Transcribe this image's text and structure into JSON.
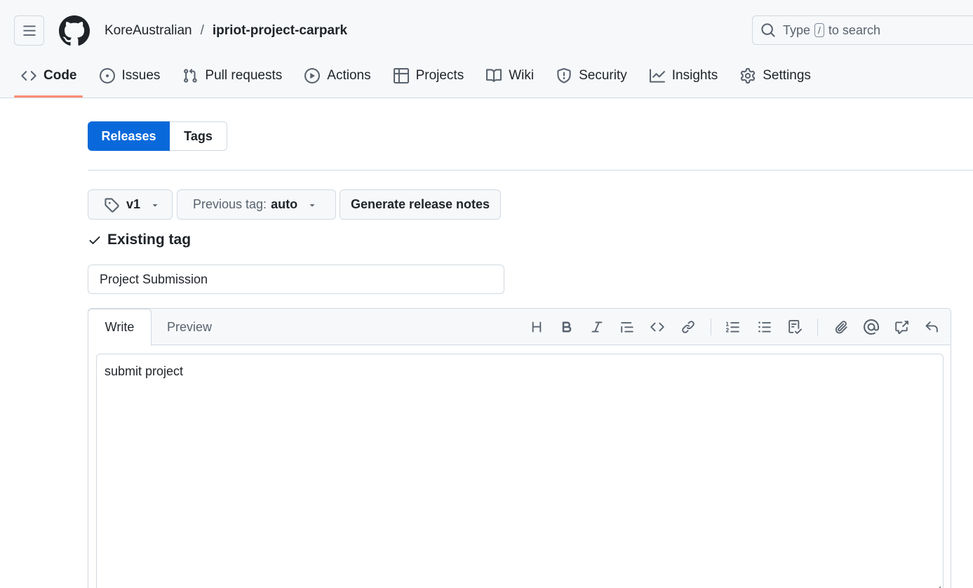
{
  "header": {
    "owner": "KoreAustralian",
    "separator": "/",
    "repo": "ipriot-project-carpark",
    "search": {
      "prefix": "Type",
      "key": "/",
      "suffix": "to search"
    }
  },
  "nav": [
    {
      "label": "Code",
      "icon": "code-icon",
      "active": true
    },
    {
      "label": "Issues",
      "icon": "issue-opened-icon"
    },
    {
      "label": "Pull requests",
      "icon": "git-pull-request-icon"
    },
    {
      "label": "Actions",
      "icon": "play-icon"
    },
    {
      "label": "Projects",
      "icon": "table-icon"
    },
    {
      "label": "Wiki",
      "icon": "book-icon"
    },
    {
      "label": "Security",
      "icon": "shield-icon"
    },
    {
      "label": "Insights",
      "icon": "graph-icon"
    },
    {
      "label": "Settings",
      "icon": "gear-icon"
    }
  ],
  "segments": {
    "releases": "Releases",
    "tags": "Tags"
  },
  "release_form": {
    "tag": "v1",
    "previous_tag_label": "Previous tag:",
    "previous_tag_value": "auto",
    "generate_notes": "Generate release notes",
    "tag_status": "Existing tag",
    "title_value": "Project Submission"
  },
  "editor": {
    "tabs": [
      "Write",
      "Preview"
    ],
    "body": "submit project",
    "toolbar": [
      "heading-icon",
      "bold-icon",
      "italic-icon",
      "quote-icon",
      "code-icon",
      "link-icon",
      "ordered-list-icon",
      "unordered-list-icon",
      "task-list-icon",
      "paperclip-icon",
      "mention-icon",
      "cross-reference-icon",
      "undo-icon"
    ]
  },
  "colors": {
    "accent": "#0969da",
    "nav_underline": "#fd8c73",
    "border": "#d1d9e0",
    "header_bg": "#f6f8fa"
  }
}
